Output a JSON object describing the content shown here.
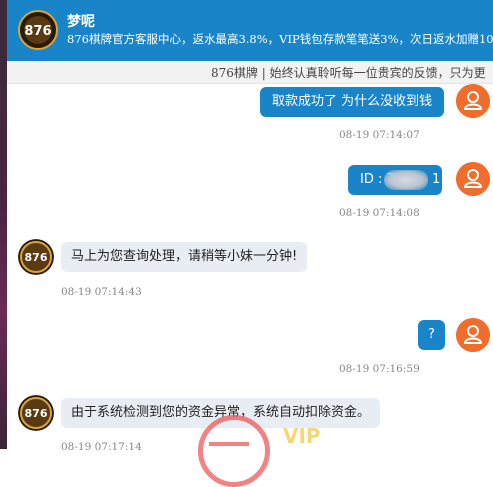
{
  "header": {
    "logo_text": "876",
    "title": "梦呢",
    "subtitle": "876棋牌官方客服中心，返水最高3.8%，VIP钱包存款笔笔送3%，次日返水加赠10"
  },
  "notice": {
    "text": "876棋牌 | 始终认真聆听每一位贵宾的反馈，只为更"
  },
  "messages": [
    {
      "sender": "user",
      "text": "取款成功了 为什么没收到钱",
      "time": "08-19 07:14:07"
    },
    {
      "sender": "user",
      "text": "ID : 75",
      "text_tail": "1",
      "time": "08-19 07:14:08"
    },
    {
      "sender": "agent",
      "text": "马上为您查询处理，请稍等小妹一分钟!",
      "time": "08-19 07:14:43"
    },
    {
      "sender": "user",
      "text": "?",
      "time": "08-19 07:16:59"
    },
    {
      "sender": "agent",
      "text": "由于系统检测到您的资金异常，系统自动扣除资金。",
      "time": "08-19 07:17:14"
    }
  ],
  "colors": {
    "accent": "#1a84c8",
    "user_avatar": "#f06d2e",
    "agent_bubble": "#e8edf3"
  },
  "icons": {
    "user_avatar": "person-icon",
    "agent_avatar": "876-logo-icon"
  }
}
